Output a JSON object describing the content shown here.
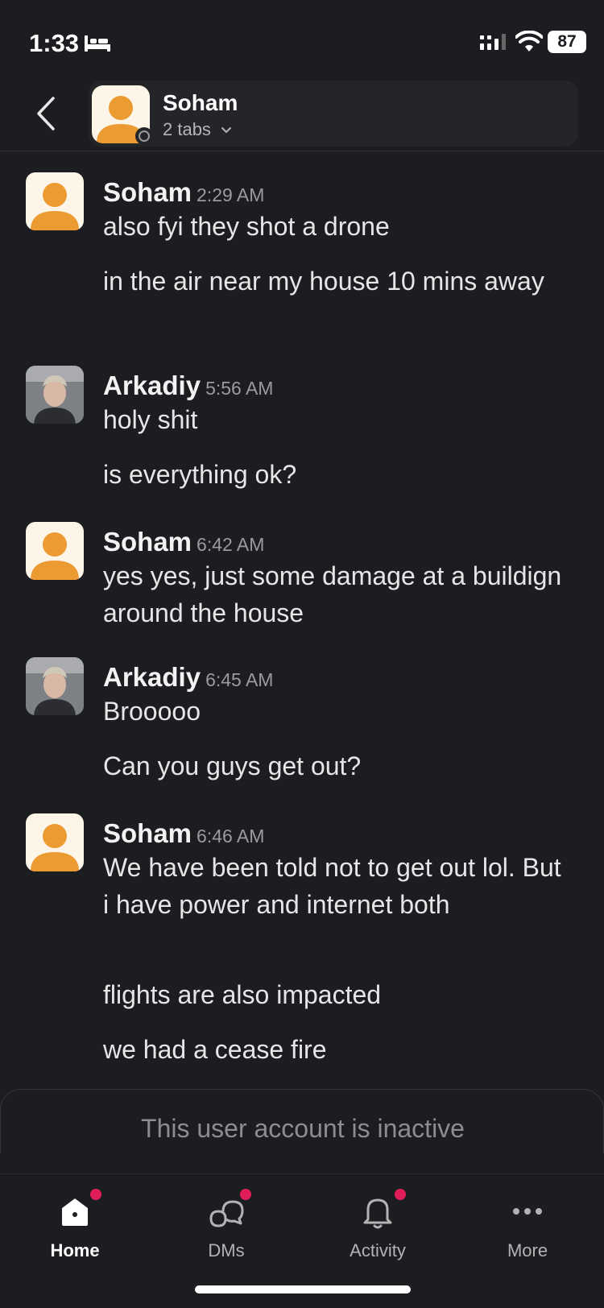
{
  "status_bar": {
    "time": "1:33",
    "battery": "87"
  },
  "header": {
    "name": "Soham",
    "subtitle": "2 tabs"
  },
  "messages": [
    {
      "author": "Soham",
      "time": "2:29 AM",
      "lines": [
        "also fyi they shot a drone",
        "in the air near my house 10 mins away"
      ]
    },
    {
      "author": "Arkadiy",
      "time": "5:56 AM",
      "lines": [
        "holy shit",
        "is everything ok?"
      ]
    },
    {
      "author": "Soham",
      "time": "6:42 AM",
      "lines": [
        "yes yes, just some damage at a buildign around the house"
      ]
    },
    {
      "author": "Arkadiy",
      "time": "6:45 AM",
      "lines": [
        "Brooooo",
        "Can you guys get out?"
      ]
    },
    {
      "author": "Soham",
      "time": "6:46 AM",
      "lines": [
        "We have been told not to get out lol. But i have power and internet both",
        "flights are also impacted",
        "we had a cease fire"
      ]
    }
  ],
  "composer": {
    "inactive_text": "This user account is inactive"
  },
  "tabs": [
    {
      "label": "Home",
      "icon": "home-icon",
      "active": true,
      "badge": true
    },
    {
      "label": "DMs",
      "icon": "dms-icon",
      "active": false,
      "badge": true
    },
    {
      "label": "Activity",
      "icon": "bell-icon",
      "active": false,
      "badge": true
    },
    {
      "label": "More",
      "icon": "more-icon",
      "active": false,
      "badge": false
    }
  ],
  "colors": {
    "background": "#1b1d21",
    "avatar_orange": "#ec9a32",
    "badge": "#e01e5a"
  }
}
